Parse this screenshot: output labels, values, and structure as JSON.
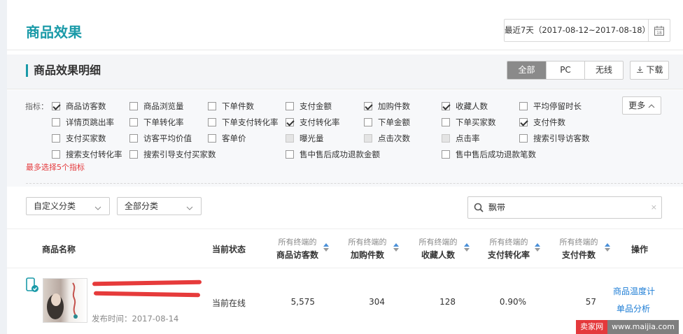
{
  "header": {
    "title": "商品效果",
    "date_range": "最近7天（2017-08-12~2017-08-18）"
  },
  "section": {
    "title": "商品效果明细",
    "tabs": [
      "全部",
      "PC",
      "无线"
    ],
    "active_tab": "全部",
    "download": "下载"
  },
  "filters": {
    "label": "指标：",
    "more": "更多",
    "warning": "最多选择5个指标",
    "items": [
      {
        "label": "商品访客数",
        "checked": true
      },
      {
        "label": "商品浏览量",
        "checked": false
      },
      {
        "label": "下单件数",
        "checked": false
      },
      {
        "label": "支付金额",
        "checked": false
      },
      {
        "label": "加购件数",
        "checked": true
      },
      {
        "label": "收藏人数",
        "checked": true
      },
      {
        "label": "平均停留时长",
        "checked": false
      },
      {
        "label": "详情页跳出率",
        "checked": false
      },
      {
        "label": "下单转化率",
        "checked": false
      },
      {
        "label": "下单支付转化率",
        "checked": false
      },
      {
        "label": "支付转化率",
        "checked": true
      },
      {
        "label": "下单金额",
        "checked": false
      },
      {
        "label": "下单买家数",
        "checked": false
      },
      {
        "label": "支付件数",
        "checked": true
      },
      {
        "label": "支付买家数",
        "checked": false
      },
      {
        "label": "访客平均价值",
        "checked": false
      },
      {
        "label": "客单价",
        "checked": false
      },
      {
        "label": "曝光量",
        "checked": false,
        "disabled": true
      },
      {
        "label": "点击次数",
        "checked": false,
        "disabled": true
      },
      {
        "label": "点击率",
        "checked": false,
        "disabled": true
      },
      {
        "label": "搜索引导访客数",
        "checked": false
      },
      {
        "label": "搜索支付转化率",
        "checked": false
      },
      {
        "label": "搜索引导支付买家数",
        "checked": false
      },
      {
        "label": "售中售后成功退款金额",
        "checked": false
      },
      {
        "label": "售中售后成功退款笔数",
        "checked": false
      }
    ]
  },
  "toolbar": {
    "category1": "自定义分类",
    "category2": "全部分类",
    "search_value": "飘带"
  },
  "table": {
    "col_product": "商品名称",
    "col_status": "当前状态",
    "col_action": "操作",
    "metric_prefix": "所有终端的",
    "metric_cols": [
      "商品访客数",
      "加购件数",
      "收藏人数",
      "支付转化率",
      "支付件数"
    ],
    "rows": [
      {
        "publish_time": "发布时间：2017-08-14",
        "status": "当前在线",
        "values": [
          "5,575",
          "304",
          "128",
          "0.90%",
          "57"
        ],
        "actions": [
          "商品温度计",
          "单品分析"
        ]
      }
    ]
  },
  "watermark": {
    "left": "卖家网",
    "right": "www.maijia.com"
  },
  "colors": {
    "accent": "#1a9aa8",
    "link": "#1c7cd5",
    "warning": "#e4393c"
  }
}
